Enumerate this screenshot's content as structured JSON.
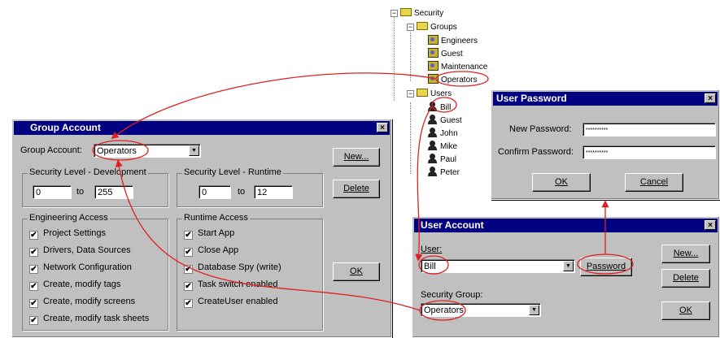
{
  "tree": {
    "root": "Security",
    "groups_label": "Groups",
    "groups": [
      "Engineers",
      "Guest",
      "Maintenance",
      "Operators"
    ],
    "users_label": "Users",
    "users": [
      "Bill",
      "Guest",
      "John",
      "Mike",
      "Paul",
      "Peter"
    ]
  },
  "group_account": {
    "title": "Group Account",
    "close": "×",
    "group_label": "Group Account:",
    "group_value": "Operators",
    "new_button": "New...",
    "delete_button": "Delete",
    "ok_button": "OK",
    "dev_title": "Security Level - Development",
    "dev_from": "0",
    "dev_to_label": "to",
    "dev_to": "255",
    "rt_title": "Security Level - Runtime",
    "rt_from": "0",
    "rt_to_label": "to",
    "rt_to": "12",
    "eng_title": "Engineering Access",
    "eng_items": [
      "Project Settings",
      "Drivers, Data Sources",
      "Network Configuration",
      "Create, modify tags",
      "Create, modify screens",
      "Create, modify task sheets"
    ],
    "rt_access_title": "Runtime Access",
    "rt_items": [
      "Start App",
      "Close App",
      "Database Spy (write)",
      "Task switch enabled",
      "CreateUser enabled"
    ],
    "check": "✔"
  },
  "user_password": {
    "title": "User Password",
    "close": "×",
    "new_pw_label": "New Password:",
    "new_pw_value": "**********",
    "confirm_label": "Confirm Password:",
    "confirm_value": "**********",
    "ok_button": "OK",
    "cancel_button": "Cancel"
  },
  "user_account": {
    "title": "User Account",
    "close": "×",
    "user_label": "User:",
    "user_value": "Bill",
    "password_button": "Password",
    "security_group_label": "Security Group:",
    "security_group_value": "Operators",
    "new_button": "New...",
    "delete_button": "Delete",
    "ok_button": "OK"
  },
  "icons": {
    "dropdown": "▼"
  },
  "colors": {
    "annotation": "#e02020",
    "titlebar": "#000080",
    "dialog": "#c0c0c0"
  }
}
